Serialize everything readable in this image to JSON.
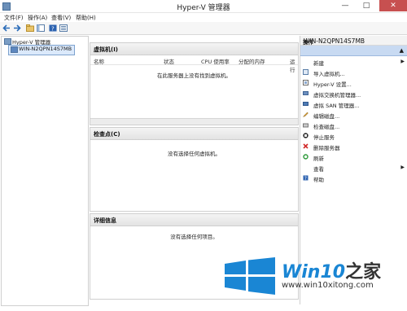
{
  "window": {
    "title": "Hyper-V 管理器",
    "min_glyph": "—",
    "max_glyph": "□",
    "close_glyph": "✕"
  },
  "menu": [
    "文件(F)",
    "操作(A)",
    "查看(V)",
    "帮助(H)"
  ],
  "tree": {
    "root": "Hyper-V 管理器",
    "server": "WIN-N2QPN14S7MB"
  },
  "vms_panel": {
    "title": "虚拟机(I)",
    "columns": [
      "名称",
      "状态",
      "CPU 使用率",
      "分配的内存",
      "运行"
    ],
    "empty_message": "在此服务器上没有找到虚拟机。"
  },
  "checkpoints_panel": {
    "title": "检查点(C)",
    "empty_message": "没有选择任何虚拟机。"
  },
  "details_panel": {
    "title": "详细信息",
    "empty_message": "没有选择任何项目。"
  },
  "actions": {
    "header": "操作",
    "group": "WIN-N2QPN14S7MB",
    "items": [
      {
        "label": "新建",
        "icon": "none",
        "submenu": true
      },
      {
        "label": "导入虚拟机...",
        "icon": "import-icon",
        "submenu": false
      },
      {
        "label": "Hyper-V 设置...",
        "icon": "settings-icon",
        "submenu": false
      },
      {
        "label": "虚拟交换机管理器...",
        "icon": "switch-icon",
        "submenu": false
      },
      {
        "label": "虚拟 SAN 管理器...",
        "icon": "san-icon",
        "submenu": false
      },
      {
        "label": "编辑磁盘...",
        "icon": "edit-disk-icon",
        "submenu": false
      },
      {
        "label": "检查磁盘...",
        "icon": "inspect-disk-icon",
        "submenu": false
      },
      {
        "label": "停止服务",
        "icon": "stop-icon",
        "submenu": false
      },
      {
        "label": "删除服务器",
        "icon": "delete-icon",
        "submenu": false
      },
      {
        "label": "刷新",
        "icon": "refresh-icon",
        "submenu": false
      },
      {
        "label": "查看",
        "icon": "none",
        "submenu": true
      },
      {
        "label": "帮助",
        "icon": "help-icon",
        "submenu": false
      }
    ]
  },
  "watermark": {
    "brand_main": "Win10",
    "brand_suffix": "之家",
    "url": "www.win10xitong.com"
  },
  "colors": {
    "accent": "#1a86d4",
    "selection": "#c8daf2"
  }
}
